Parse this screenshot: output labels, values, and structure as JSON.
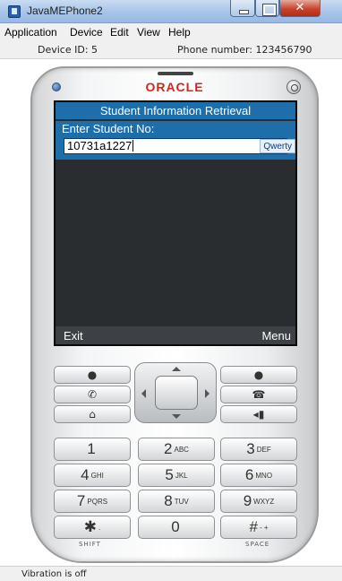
{
  "window": {
    "title": "JavaMEPhone2"
  },
  "menu": {
    "items": [
      "Application",
      "Device",
      "Edit",
      "View",
      "Help"
    ]
  },
  "device_info": {
    "device_id": "Device ID: 5",
    "phone_number": "Phone number: 123456790"
  },
  "phone": {
    "brand": "ORACLE",
    "screen": {
      "title": "Student Information Retrieval",
      "field_label": "Enter Student No:",
      "field_value": "10731a1227",
      "input_mode": "Qwerty",
      "softkey_left": "Exit",
      "softkey_right": "Menu"
    },
    "keys": {
      "k1": {
        "num": "1",
        "letters": ""
      },
      "k2": {
        "num": "2",
        "letters": "ABC"
      },
      "k3": {
        "num": "3",
        "letters": "DEF"
      },
      "k4": {
        "num": "4",
        "letters": "GHI"
      },
      "k5": {
        "num": "5",
        "letters": "JKL"
      },
      "k6": {
        "num": "6",
        "letters": "MNO"
      },
      "k7": {
        "num": "7",
        "letters": "PQRS"
      },
      "k8": {
        "num": "8",
        "letters": "TUV"
      },
      "k9": {
        "num": "9",
        "letters": "WXYZ"
      },
      "kstar": {
        "num": "✱",
        "letters": "."
      },
      "k0": {
        "num": "0",
        "letters": ""
      },
      "khash": {
        "num": "#",
        "letters": "- +"
      }
    },
    "key_captions": {
      "shift": "SHIFT",
      "space": "SPACE"
    }
  },
  "status": {
    "text": "Vibration is off"
  }
}
